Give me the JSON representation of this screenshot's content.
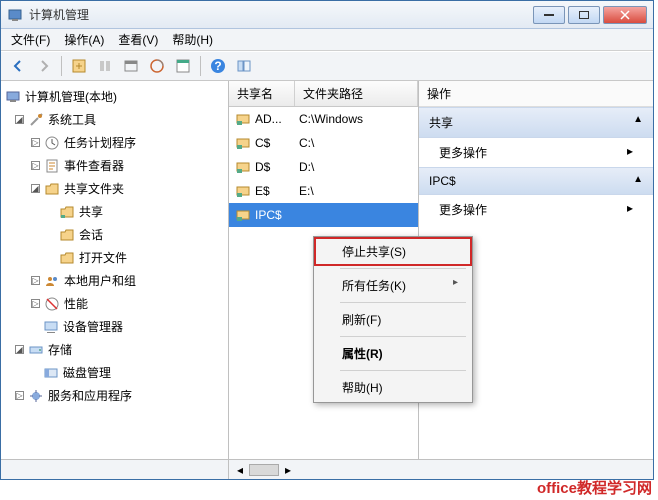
{
  "window": {
    "title": "计算机管理"
  },
  "menubar": {
    "file": "文件(F)",
    "action": "操作(A)",
    "view": "查看(V)",
    "help": "帮助(H)"
  },
  "tree": {
    "root": "计算机管理(本地)",
    "system_tools": "系统工具",
    "task_scheduler": "任务计划程序",
    "event_viewer": "事件查看器",
    "shared_folders": "共享文件夹",
    "shares": "共享",
    "sessions": "会话",
    "open_files": "打开文件",
    "local_users": "本地用户和组",
    "performance": "性能",
    "device_manager": "设备管理器",
    "storage": "存储",
    "disk_manager": "磁盘管理",
    "services": "服务和应用程序"
  },
  "list": {
    "col_share": "共享名",
    "col_path": "文件夹路径",
    "rows": [
      {
        "share": "AD...",
        "path": "C:\\Windows"
      },
      {
        "share": "C$",
        "path": "C:\\"
      },
      {
        "share": "D$",
        "path": "D:\\"
      },
      {
        "share": "E$",
        "path": "E:\\"
      },
      {
        "share": "IPC$",
        "path": ""
      }
    ]
  },
  "actions_pane": {
    "title": "操作",
    "section1": "共享",
    "more1": "更多操作",
    "section2": "IPC$",
    "more2": "更多操作"
  },
  "context_menu": {
    "stop_share": "停止共享(S)",
    "all_tasks": "所有任务(K)",
    "refresh": "刷新(F)",
    "properties": "属性(R)",
    "help": "帮助(H)"
  },
  "watermark": "office教程学习网"
}
